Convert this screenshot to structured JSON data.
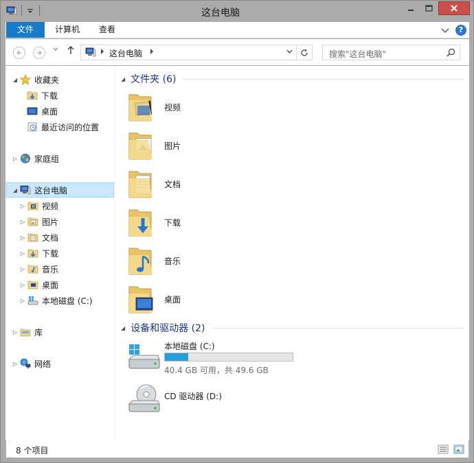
{
  "window": {
    "title": "这台电脑"
  },
  "ribbon": {
    "tabs": [
      "文件",
      "计算机",
      "查看"
    ],
    "help_label": "?"
  },
  "nav": {
    "address": "这台电脑",
    "search_placeholder": "搜索\"这台电脑\""
  },
  "navpane": {
    "favorites": {
      "label": "收藏夹",
      "items": [
        "下载",
        "桌面",
        "最近访问的位置"
      ]
    },
    "homegroup": "家庭组",
    "this_pc": {
      "label": "这台电脑",
      "items": [
        "视频",
        "图片",
        "文档",
        "下载",
        "音乐",
        "桌面",
        "本地磁盘 (C:)"
      ]
    },
    "libraries": "库",
    "network": "网络"
  },
  "content": {
    "folders_header": "文件夹 (6)",
    "folders": [
      "视频",
      "图片",
      "文档",
      "下载",
      "音乐",
      "桌面"
    ],
    "devices_header": "设备和驱动器 (2)",
    "drives": [
      {
        "name": "本地磁盘 (C:)",
        "info": "40.4 GB 可用，共 49.6 GB",
        "used_fraction": 0.185
      },
      {
        "name": "CD 驱动器 (D:)"
      }
    ]
  },
  "status": {
    "count": "8 个项目"
  },
  "colors": {
    "accent": "#1979ca",
    "selection": "#cce8ff",
    "group_header": "#1e3287",
    "drive_fill": "#26a0da",
    "close": "#c7504a"
  }
}
